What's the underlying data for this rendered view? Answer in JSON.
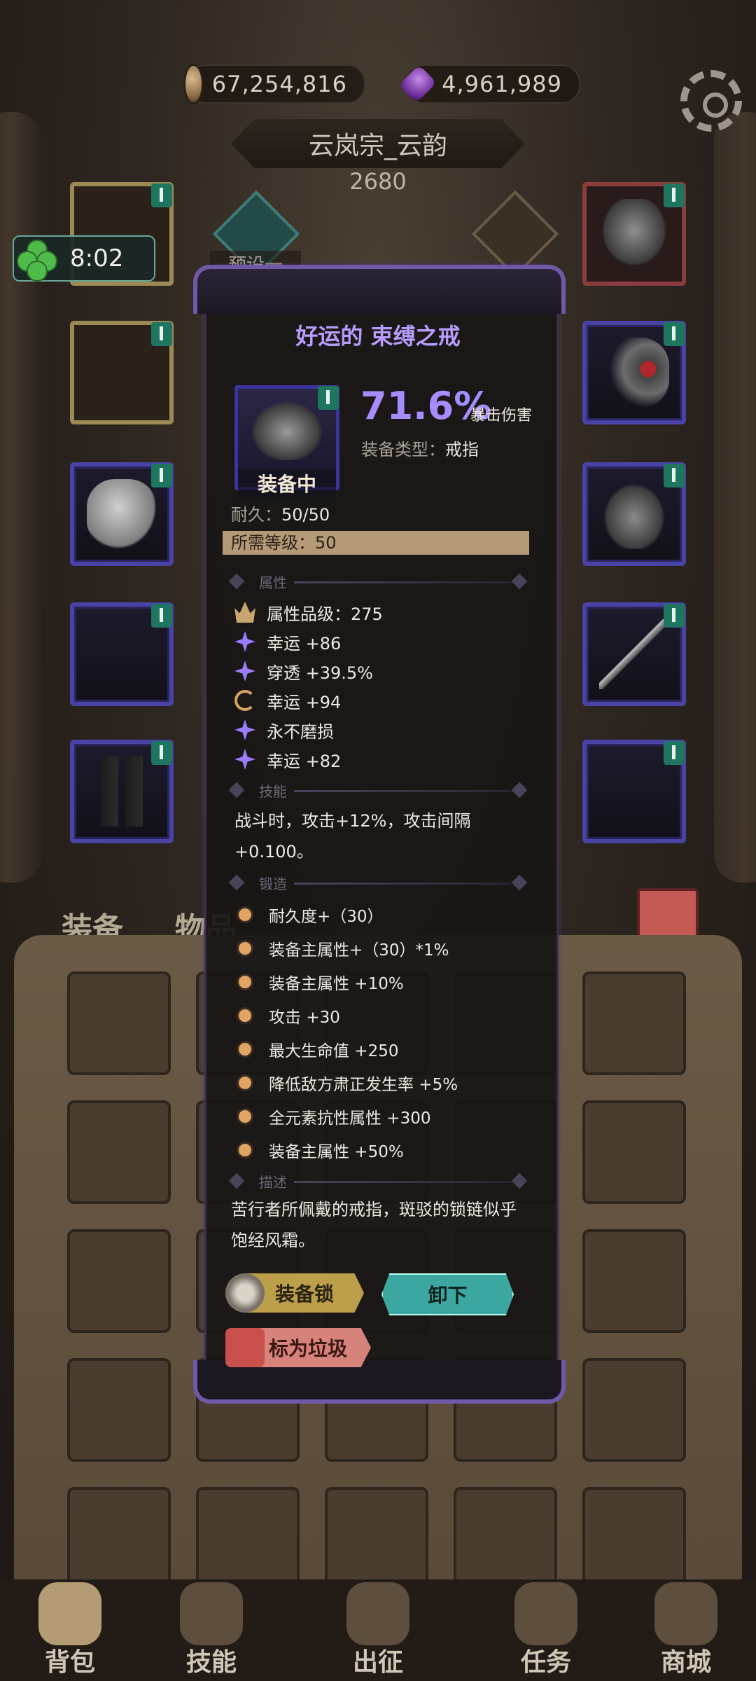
{
  "currency": {
    "gold": "67,254,816",
    "gems": "4,961,989"
  },
  "player": {
    "name": "云岚宗_云韵",
    "power": "2680"
  },
  "buff": {
    "timer": "8:02"
  },
  "preset": {
    "label": "预设一"
  },
  "tooltip": {
    "item_name": "好运的 束缚之戒",
    "equipped_label": "装备中",
    "crit_value": "71.6%",
    "crit_label": "暴击伤害",
    "type_label": "装备类型：",
    "type_value": "戒指",
    "durability_label": "耐久：",
    "durability_value": "50/50",
    "required_level_label": "所需等级：",
    "required_level_value": "50",
    "sections": {
      "attributes": "属性",
      "skill": "技能",
      "forging": "锻造",
      "description": "描述"
    },
    "attributes": [
      {
        "icon": "crown-icon",
        "text": "属性品级：275"
      },
      {
        "icon": "purple-star-icon",
        "text": "幸运 +86"
      },
      {
        "icon": "purple-star-icon",
        "text": "穿透 +39.5%"
      },
      {
        "icon": "cycle-icon",
        "text": "幸运 +94"
      },
      {
        "icon": "purple-star-icon",
        "text": "永不磨损"
      },
      {
        "icon": "purple-star-icon",
        "text": "幸运 +82"
      }
    ],
    "skill_text": "战斗时，攻击+12%，攻击间隔 +0.100。",
    "forging": [
      "耐久度+（30）",
      "装备主属性+（30）*1%",
      "装备主属性 +10%",
      "攻击 +30",
      "最大生命值 +250",
      "降低敌方肃正发生率 +5%",
      "全元素抗性属性 +300",
      "装备主属性 +50%"
    ],
    "description_text": "苦行者所佩戴的戒指，斑驳的锁链似乎饱经风霜。",
    "buttons": {
      "lock": "装备锁",
      "unequip": "卸下",
      "junk": "标为垃圾"
    }
  },
  "bag_tabs": {
    "equipment": "装备",
    "items": "物品"
  },
  "nav": [
    "背包",
    "技能",
    "出征",
    "任务",
    "商城"
  ],
  "colors": {
    "accent_purple": "#a88cff",
    "teal_button": "#3ca7a0",
    "gold_button": "#bb9f4a"
  }
}
